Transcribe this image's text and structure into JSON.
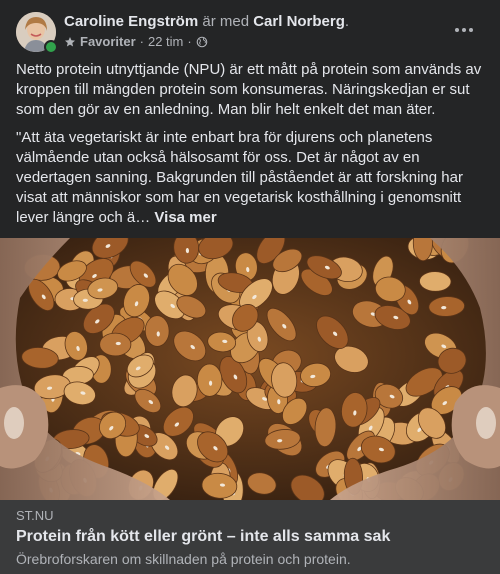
{
  "post": {
    "author": "Caroline Engström",
    "with_text": "är med",
    "tagged": "Carl Norberg",
    "period": ".",
    "group_label": "Favoriter",
    "separator": "·",
    "time": "22 tim",
    "separator2": "·",
    "paragraph1": "Netto protein utnyttjande (NPU) är ett mått på protein som används av kroppen till mängden protein som konsumeras. Näringskedjan er sut som den gör av en anledning. Man blir helt enkelt det man äter.",
    "paragraph2": "\"Att äta vegetariskt är inte enbart bra för djurens och planetens välmående utan också hälsosamt för oss. Det är något av en vedertagen sanning. Bakgrunden till påståendet är att forskning har visat att människor som har en vegetarisk kosthållning i genomsnitt lever längre och ä…",
    "see_more": "Visa mer"
  },
  "link": {
    "domain": "ST.NU",
    "title": "Protein från kött eller grönt – inte alls samma sak",
    "description": "Örebroforskaren om skillnaden på protein och protein."
  },
  "icons": {
    "star": "star-icon",
    "globe": "globe-icon",
    "more": "more-options-icon"
  },
  "colors": {
    "background": "#242526",
    "card": "#3a3b3c",
    "text": "#e4e6eb",
    "muted": "#b0b3b8",
    "online": "#31a24c"
  }
}
